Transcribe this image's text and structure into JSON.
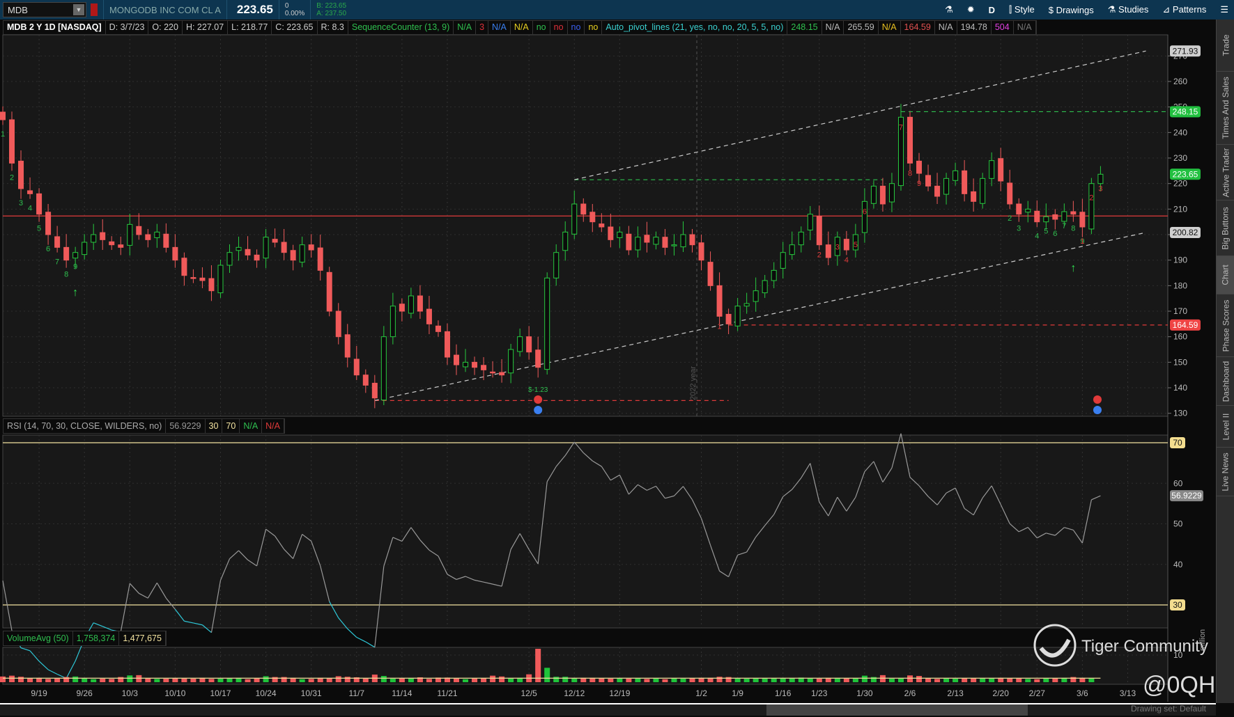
{
  "toolbar": {
    "symbol": "MDB",
    "company": "MONGODB INC COM CL A",
    "last": "223.65",
    "net_change": "0",
    "pct_change": "0.00%",
    "bid": "B: 223.65",
    "ask": "A: 237.50",
    "period": "D",
    "style": "Style",
    "drawings": "Drawings",
    "studies": "Studies",
    "patterns": "Patterns"
  },
  "header": {
    "title": "MDB 2 Y 1D [NASDAQ]",
    "date": "D: 3/7/23",
    "open": "O: 220",
    "high": "H: 227.07",
    "low": "L: 218.77",
    "close": "C: 223.65",
    "range": "R: 8.3",
    "seq_label": "SequenceCounter (13, 9)",
    "seq_vals": [
      {
        "t": "N/A",
        "c": "#2fbf4f"
      },
      {
        "t": "3",
        "c": "#e0303a"
      },
      {
        "t": "N/A",
        "c": "#3a7ff0"
      },
      {
        "t": "N/A",
        "c": "#e8d020"
      },
      {
        "t": "no",
        "c": "#2fbf4f"
      },
      {
        "t": "no",
        "c": "#e0303a"
      },
      {
        "t": "no",
        "c": "#3a5ff0"
      },
      {
        "t": "no",
        "c": "#e8d020"
      }
    ],
    "pivot_label": "Auto_pivot_lines (21, yes, no, no, 20, 5, 5, no)",
    "pivot_vals": [
      {
        "t": "248.15",
        "c": "#2fbf4f"
      },
      {
        "t": "N/A",
        "c": "#bbb"
      },
      {
        "t": "265.59",
        "c": "#bbb"
      },
      {
        "t": "N/A",
        "c": "#e8c020"
      },
      {
        "t": "164.59",
        "c": "#e05050"
      },
      {
        "t": "N/A",
        "c": "#bbb"
      },
      {
        "t": "194.78",
        "c": "#bbb"
      },
      {
        "t": "504",
        "c": "#e040e0"
      },
      {
        "t": "N/A",
        "c": "#777"
      }
    ]
  },
  "rsi_header": {
    "label": "RSI (14, 70, 30, CLOSE, WILDERS, no)",
    "value": "56.9229",
    "os": "30",
    "ob": "70",
    "na1": "N/A",
    "na2": "N/A"
  },
  "volume_header": {
    "label": "VolumeAvg (50)",
    "volume": "1,758,374",
    "avg": "1,477,675"
  },
  "price_tags": [
    {
      "t": "271.93",
      "v": 271.93,
      "bg": "#cfcfcf",
      "fg": "#111"
    },
    {
      "t": "248.15",
      "v": 248.15,
      "bg": "#22c040",
      "fg": "#fff"
    },
    {
      "t": "223.65",
      "v": 223.65,
      "bg": "#22c040",
      "fg": "#fff"
    },
    {
      "t": "200.82",
      "v": 200.82,
      "bg": "#cfcfcf",
      "fg": "#111"
    },
    {
      "t": "164.59",
      "v": 164.59,
      "bg": "#ef4444",
      "fg": "#fff"
    }
  ],
  "rsi_tags": [
    {
      "t": "70",
      "v": 70,
      "bg": "#f3dd8f",
      "fg": "#111"
    },
    {
      "t": "56.9229",
      "v": 56.9229,
      "bg": "#888",
      "fg": "#fff"
    },
    {
      "t": "30",
      "v": 30,
      "bg": "#f3dd8f",
      "fg": "#111"
    }
  ],
  "year_label": "2022 year",
  "dividend_label": "$-1.23",
  "volume_axis_label": "10",
  "volume_unit": "million",
  "watermark": {
    "brand": "Tiger Community",
    "user": "@0QH"
  },
  "sidebar": [
    "Trade",
    "Times And Sales",
    "Active Trader",
    "Big Buttons",
    "Chart",
    "Phase Scores",
    "Dashboard",
    "Level II",
    "Live News"
  ],
  "sidebar_active": "Chart",
  "footer": "Drawing set: Default",
  "chart_data": {
    "type": "candlestick",
    "title": "MDB 2 Y 1D [NASDAQ]",
    "price_ticks": [
      130,
      140,
      150,
      160,
      170,
      180,
      190,
      200,
      210,
      220,
      230,
      240,
      250,
      260,
      270
    ],
    "rsi_ticks": [
      30,
      40,
      50,
      60,
      70
    ],
    "x_labels": [
      {
        "t": "9/19",
        "i": 4
      },
      {
        "t": "9/26",
        "i": 9
      },
      {
        "t": "10/3",
        "i": 14
      },
      {
        "t": "10/10",
        "i": 19
      },
      {
        "t": "10/17",
        "i": 24
      },
      {
        "t": "10/24",
        "i": 29
      },
      {
        "t": "10/31",
        "i": 34
      },
      {
        "t": "11/7",
        "i": 39
      },
      {
        "t": "11/14",
        "i": 44
      },
      {
        "t": "11/21",
        "i": 49
      },
      {
        "t": "12/5",
        "i": 58
      },
      {
        "t": "12/12",
        "i": 63
      },
      {
        "t": "12/19",
        "i": 68
      },
      {
        "t": "1/2",
        "i": 77
      },
      {
        "t": "1/9",
        "i": 81
      },
      {
        "t": "1/16",
        "i": 86
      },
      {
        "t": "1/23",
        "i": 90
      },
      {
        "t": "1/30",
        "i": 95
      },
      {
        "t": "2/6",
        "i": 100
      },
      {
        "t": "2/13",
        "i": 105
      },
      {
        "t": "2/20",
        "i": 110
      },
      {
        "t": "2/27",
        "i": 114
      },
      {
        "t": "3/6",
        "i": 119
      },
      {
        "t": "3/13",
        "i": 124
      }
    ],
    "close": [
      245,
      228,
      218,
      216,
      208,
      200,
      195,
      190,
      193,
      197,
      200,
      198,
      196,
      195,
      204,
      200,
      198,
      201,
      195,
      190,
      184,
      183,
      182,
      178,
      188,
      193,
      195,
      192,
      190,
      199,
      197,
      193,
      190,
      196,
      194,
      186,
      170,
      160,
      152,
      145,
      141,
      136,
      160,
      172,
      170,
      176,
      170,
      165,
      162,
      152,
      149,
      150,
      148,
      147,
      146,
      145,
      155,
      160,
      154,
      148,
      183,
      193,
      201,
      212,
      208,
      205,
      203,
      198,
      201,
      194,
      199,
      197,
      199,
      195,
      196,
      200,
      196,
      190,
      180,
      168,
      165,
      172,
      173,
      178,
      182,
      186,
      193,
      196,
      201,
      208,
      196,
      191,
      199,
      194,
      200,
      213,
      219,
      212,
      220,
      246,
      228,
      224,
      219,
      215,
      222,
      225,
      216,
      213,
      222,
      229,
      221,
      212,
      208,
      210,
      205,
      207,
      206,
      209,
      208,
      203,
      220,
      223.65
    ],
    "volume_millions": [
      2.1,
      2.4,
      2.0,
      1.5,
      1.6,
      1.2,
      1.4,
      1.9,
      2.1,
      1.4,
      1.1,
      1.3,
      1.2,
      1.9,
      2.5,
      2.6,
      1.4,
      1.2,
      1.3,
      1.5,
      1.4,
      1.3,
      1.6,
      1.2,
      1.3,
      1.4,
      1.6,
      1.1,
      1.4,
      2.2,
      1.9,
      1.9,
      1.6,
      1.1,
      1.2,
      1.6,
      1.5,
      2.2,
      2.0,
      1.8,
      1.4,
      2.8,
      2.3,
      1.3,
      1.4,
      1.5,
      1.8,
      1.2,
      1.7,
      1.7,
      1.4,
      1.1,
      1.4,
      1.5,
      2.4,
      2.1,
      1.5,
      1.6,
      2.9,
      12.3,
      5.3,
      2.0,
      2.0,
      1.5,
      1.6,
      1.6,
      1.4,
      1.3,
      1.5,
      1.3,
      1.4,
      1.2,
      1.4,
      1.1,
      1.4,
      1.3,
      1.5,
      1.6,
      1.6,
      2.0,
      1.9,
      1.5,
      1.3,
      1.4,
      1.4,
      1.5,
      1.4,
      1.5,
      1.7,
      1.4,
      1.3,
      1.6,
      1.6,
      1.4,
      1.5,
      2.4,
      1.9,
      2.6,
      1.3,
      1.4,
      2.5,
      2.3,
      1.5,
      1.2,
      1.4,
      1.3,
      1.5,
      1.5,
      1.4,
      1.5,
      1.6,
      1.4,
      1.4,
      1.2,
      1.1,
      1.4,
      1.5,
      1.6,
      1.9,
      1.6,
      1.5
    ],
    "volume_avg_millions": 1.48,
    "sequence_labels": [
      {
        "i": 0,
        "t": "1",
        "c": "#2fbf4f"
      },
      {
        "i": 1,
        "t": "2",
        "c": "#2fbf4f"
      },
      {
        "i": 2,
        "t": "3",
        "c": "#2fbf4f"
      },
      {
        "i": 3,
        "t": "4",
        "c": "#2fbf4f"
      },
      {
        "i": 4,
        "t": "5",
        "c": "#2fbf4f"
      },
      {
        "i": 5,
        "t": "6",
        "c": "#2fbf4f"
      },
      {
        "i": 6,
        "t": "7",
        "c": "#2fbf4f"
      },
      {
        "i": 7,
        "t": "8",
        "c": "#2fbf4f"
      },
      {
        "i": 8,
        "t": "9",
        "c": "#2fbf4f"
      },
      {
        "i": 79,
        "t": "1",
        "c": "#e03a3a"
      },
      {
        "i": 90,
        "t": "2",
        "c": "#e03a3a"
      },
      {
        "i": 92,
        "t": "3",
        "c": "#e03a3a"
      },
      {
        "i": 93,
        "t": "4",
        "c": "#e03a3a"
      },
      {
        "i": 94,
        "t": "5",
        "c": "#e03a3a"
      },
      {
        "i": 95,
        "t": "6",
        "c": "#e03a3a"
      },
      {
        "i": 99,
        "t": "7",
        "c": "#e03a3a"
      },
      {
        "i": 100,
        "t": "8",
        "c": "#e03a3a"
      },
      {
        "i": 101,
        "t": "9",
        "c": "#e03a3a"
      },
      {
        "i": 111,
        "t": "2",
        "c": "#2fbf4f"
      },
      {
        "i": 112,
        "t": "3",
        "c": "#2fbf4f"
      },
      {
        "i": 114,
        "t": "4",
        "c": "#2fbf4f"
      },
      {
        "i": 115,
        "t": "5",
        "c": "#2fbf4f"
      },
      {
        "i": 116,
        "t": "6",
        "c": "#2fbf4f"
      },
      {
        "i": 117,
        "t": "7",
        "c": "#2fbf4f"
      },
      {
        "i": 118,
        "t": "8",
        "c": "#2fbf4f"
      },
      {
        "i": 119,
        "t": "9",
        "c": "#2fbf4f"
      },
      {
        "i": 119,
        "t": "1",
        "c": "#e03a3a"
      },
      {
        "i": 120,
        "t": "2",
        "c": "#e03a3a"
      },
      {
        "i": 121,
        "t": "3",
        "c": "#e03a3a"
      }
    ],
    "lines": [
      {
        "name": "resistance-line",
        "from": [
          0,
          207.3
        ],
        "to": [
          130,
          207.3
        ],
        "color": "#e03a3a",
        "dash": false
      },
      {
        "name": "pivot-high-248",
        "from": [
          99,
          248.15
        ],
        "to": [
          130,
          248.15
        ],
        "color": "#2fbf4f",
        "dash": true
      },
      {
        "name": "pivot-high-221",
        "from": [
          63,
          221.5
        ],
        "to": [
          97,
          221.5
        ],
        "color": "#2fbf4f",
        "dash": true
      },
      {
        "name": "pivot-low-164",
        "from": [
          80,
          164.59
        ],
        "to": [
          130,
          164.59
        ],
        "color": "#e03a3a",
        "dash": true
      },
      {
        "name": "pivot-low-135",
        "from": [
          41,
          135
        ],
        "to": [
          80,
          135
        ],
        "color": "#e03a3a",
        "dash": true
      },
      {
        "name": "upper-channel",
        "from": [
          63,
          221.5
        ],
        "to": [
          126,
          271.93
        ],
        "color": "#ccc",
        "dash": true
      },
      {
        "name": "lower-channel",
        "from": [
          41,
          135
        ],
        "to": [
          126,
          200.82
        ],
        "color": "#ccc",
        "dash": true
      }
    ]
  }
}
